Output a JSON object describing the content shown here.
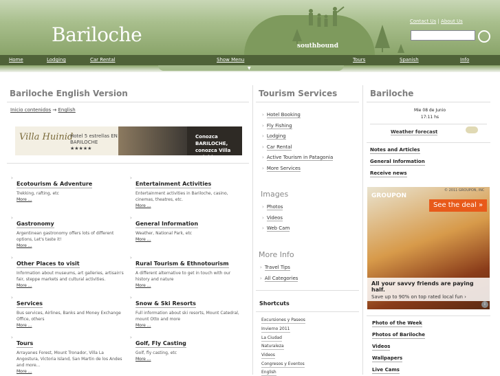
{
  "header": {
    "logo": "Bariloche",
    "tagline": "southbound",
    "contact": "Contact Us",
    "about": "About Us",
    "search_placeholder": ""
  },
  "nav": [
    "Home",
    "Lodging",
    "Car Rental",
    "Show Menu",
    "Tours",
    "Spanish",
    "Info"
  ],
  "left": {
    "title": "Bariloche English Version",
    "crumb": {
      "home": "Inicio contenidos",
      "arrow": "→",
      "current": "English"
    },
    "banner": {
      "logo": "Villa Huinid",
      "stars": "Hotel 5 estrellas EN BARILOCHE",
      "rating": "★★★★★",
      "promo1": "Conozca BARILOCHE,",
      "promo2": "conozca Villa Huinid..."
    },
    "categories": [
      {
        "title": "Ecotourism & Adventure",
        "desc": "Trekking, rafting, etc",
        "more": "More ..."
      },
      {
        "title": "Entertainment Activities",
        "desc": "Entertainment activities in Bariloche, casino, cinemas, theatres, etc.",
        "more": "More ..."
      },
      {
        "title": "Gastronomy",
        "desc": "Argentinean gastronomy offers lots of different options, Let's taste it!",
        "more": "More ..."
      },
      {
        "title": "General Information",
        "desc": "Weather, National Park, etc",
        "more": "More ..."
      },
      {
        "title": "Other Places to visit",
        "desc": "Information about museums, art galleries, artisain's fair, steppe markets and cultural activities.",
        "more": "More ..."
      },
      {
        "title": "Rural Tourism & Ethnotourism",
        "desc": "A different alternative to get in touch with our history and nature",
        "more": "More ..."
      },
      {
        "title": "Services",
        "desc": "Bus services, Airlines, Banks and Money Exchange Office, others",
        "more": "More ..."
      },
      {
        "title": "Snow & Ski Resorts",
        "desc": "Full information about ski resorts, Mount Catedral, mount Otto and more",
        "more": "More ..."
      },
      {
        "title": "Tours",
        "desc": "Arrayanes Forest, Mount Tronador, Villa La Angostura, Victoria Island, San Martin de los Andes and more...",
        "more": "More ..."
      },
      {
        "title": "Golf, Fly Casting",
        "desc": "Golf, fly casting, etc",
        "more": "More ..."
      }
    ]
  },
  "middle": {
    "title": "Tourism Services",
    "services": [
      "Hotel Booking",
      "Fly Fishing",
      "Lodging",
      "Car Rental",
      "Active Tourism in Patagonia",
      "More Services"
    ],
    "images_title": "Images",
    "images": [
      "Photos",
      "Videos",
      "Web Cam"
    ],
    "moreinfo_title": "More Info",
    "moreinfo": [
      "Travel Tips",
      "All Categories"
    ],
    "shortcuts_title": "Shortcuts",
    "shortcuts": [
      "Excursiones y Paseos",
      "Invierno 2011",
      "La Ciudad",
      "Naturaleza",
      "Videos",
      "Congresos y Eventos",
      "English"
    ]
  },
  "right": {
    "title": "Bariloche",
    "date": "Mie 08 de Junio",
    "time": "17:11 hs",
    "weather": "Weather forecast",
    "links": [
      "Notes and Articles",
      "General Information",
      "Receive news"
    ],
    "ad": {
      "brand": "GROUPON",
      "copyright": "© 2011 GROUPON, INC",
      "cta": "See the deal »",
      "headline": "All your savvy friends are paying half.",
      "sub": "Save up to 90% on top rated local fun ›",
      "info": "i"
    },
    "bottom_links": [
      "Photo of the Week",
      "Photos of Bariloche",
      "Videos",
      "Wallpapers",
      "Live Cams"
    ]
  }
}
